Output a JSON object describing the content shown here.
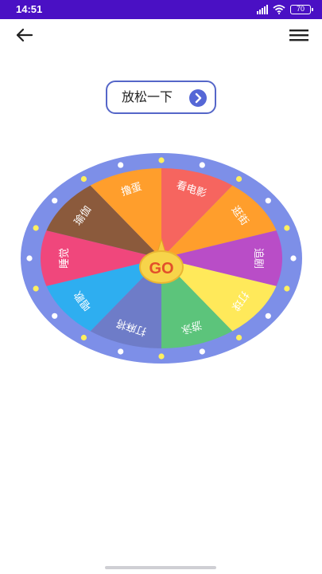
{
  "status_bar": {
    "time": "14:51",
    "battery": "70",
    "background": "#4a10c4"
  },
  "toolbar": {
    "back_icon": "arrow-left-icon",
    "menu_icon": "hamburger-menu-icon"
  },
  "relax_button": {
    "label": "放松一下",
    "icon": "chevron-right-icon",
    "border_color": "#5566c8"
  },
  "wheel": {
    "rim_color": "#7d8fe8",
    "center_label": "GO",
    "center_color": "#f7d44a",
    "segments": [
      {
        "label": "看电影",
        "color": "#f6655f"
      },
      {
        "label": "逛街",
        "color": "#ff9e2c"
      },
      {
        "label": "追剧",
        "color": "#b94dc7"
      },
      {
        "label": "打球",
        "color": "#ffe95a"
      },
      {
        "label": "游泳",
        "color": "#5cc47b"
      },
      {
        "label": "打麻将",
        "color": "#6e7cc8"
      },
      {
        "label": "唱歌",
        "color": "#2eaef0"
      },
      {
        "label": "睡觉",
        "color": "#f0477c"
      },
      {
        "label": "瑜伽",
        "color": "#8b5a3c"
      },
      {
        "label": "撸蛋",
        "color": "#ff9e2c"
      }
    ]
  }
}
